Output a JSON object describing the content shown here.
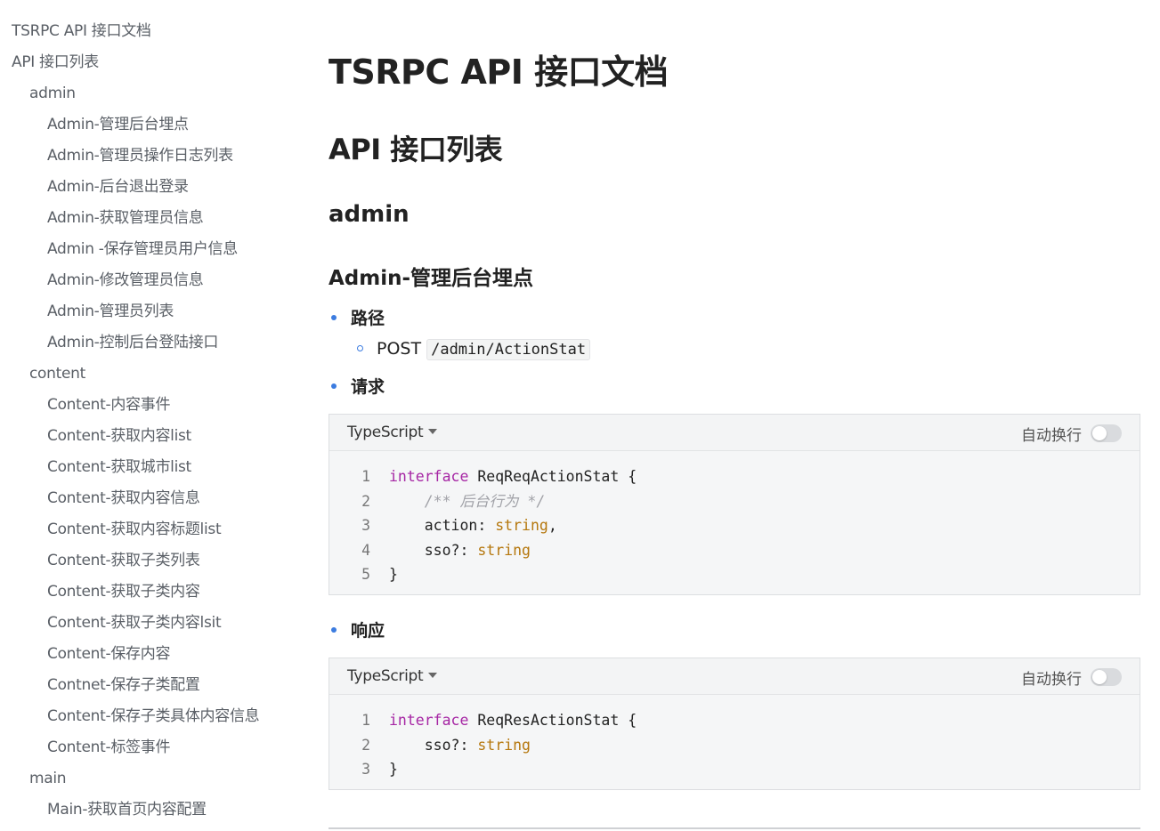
{
  "sidebar": {
    "items": [
      {
        "label": "TSRPC API 接口文档",
        "level": 0
      },
      {
        "label": "API 接口列表",
        "level": 0
      },
      {
        "label": "admin",
        "level": 1
      },
      {
        "label": "Admin-管理后台埋点",
        "level": 2
      },
      {
        "label": "Admin-管理员操作日志列表",
        "level": 2
      },
      {
        "label": "Admin-后台退出登录",
        "level": 2
      },
      {
        "label": "Admin-获取管理员信息",
        "level": 2
      },
      {
        "label": "Admin -保存管理员用户信息",
        "level": 2
      },
      {
        "label": "Admin-修改管理员信息",
        "level": 2
      },
      {
        "label": "Admin-管理员列表",
        "level": 2
      },
      {
        "label": "Admin-控制后台登陆接口",
        "level": 2
      },
      {
        "label": "content",
        "level": 1
      },
      {
        "label": "Content-内容事件",
        "level": 2
      },
      {
        "label": "Content-获取内容list",
        "level": 2
      },
      {
        "label": "Content-获取城市list",
        "level": 2
      },
      {
        "label": "Content-获取内容信息",
        "level": 2
      },
      {
        "label": "Content-获取内容标题list",
        "level": 2
      },
      {
        "label": "Content-获取子类列表",
        "level": 2
      },
      {
        "label": "Content-获取子类内容",
        "level": 2
      },
      {
        "label": "Content-获取子类内容lsit",
        "level": 2
      },
      {
        "label": "Content-保存内容",
        "level": 2
      },
      {
        "label": "Contnet-保存子类配置",
        "level": 2
      },
      {
        "label": "Content-保存子类具体内容信息",
        "level": 2
      },
      {
        "label": "Content-标签事件",
        "level": 2
      },
      {
        "label": "main",
        "level": 1
      },
      {
        "label": "Main-获取首页内容配置",
        "level": 2
      }
    ]
  },
  "main": {
    "doc_title": "TSRPC API 接口文档",
    "section_title": "API 接口列表",
    "group_title": "admin",
    "api_title": "Admin-管理后台埋点",
    "path_label": "路径",
    "method": "POST",
    "path": "/admin/ActionStat",
    "request_label": "请求",
    "response_label": "响应",
    "request_block": {
      "lang": "TypeScript",
      "wrap_label": "自动换行",
      "wrap_enabled": false,
      "lines": [
        {
          "n": "1",
          "kw": "interface",
          "name": " ReqReqActionStat {"
        },
        {
          "n": "2",
          "comment": "    /** 后台行为 */"
        },
        {
          "n": "3",
          "field": "    action: ",
          "type": "string",
          "tail": ","
        },
        {
          "n": "4",
          "field": "    sso?: ",
          "type": "string",
          "tail": ""
        },
        {
          "n": "5",
          "plain": "}"
        }
      ]
    },
    "response_block": {
      "lang": "TypeScript",
      "wrap_label": "自动换行",
      "wrap_enabled": false,
      "lines": [
        {
          "n": "1",
          "kw": "interface",
          "name": " ReqResActionStat {"
        },
        {
          "n": "2",
          "field": "    sso?: ",
          "type": "string",
          "tail": ""
        },
        {
          "n": "3",
          "plain": "}"
        }
      ]
    }
  },
  "colors": {
    "bullet": "#3c7ce0",
    "keyword": "#a626a4",
    "type": "#b5770d",
    "comment": "#a0a1a7"
  }
}
